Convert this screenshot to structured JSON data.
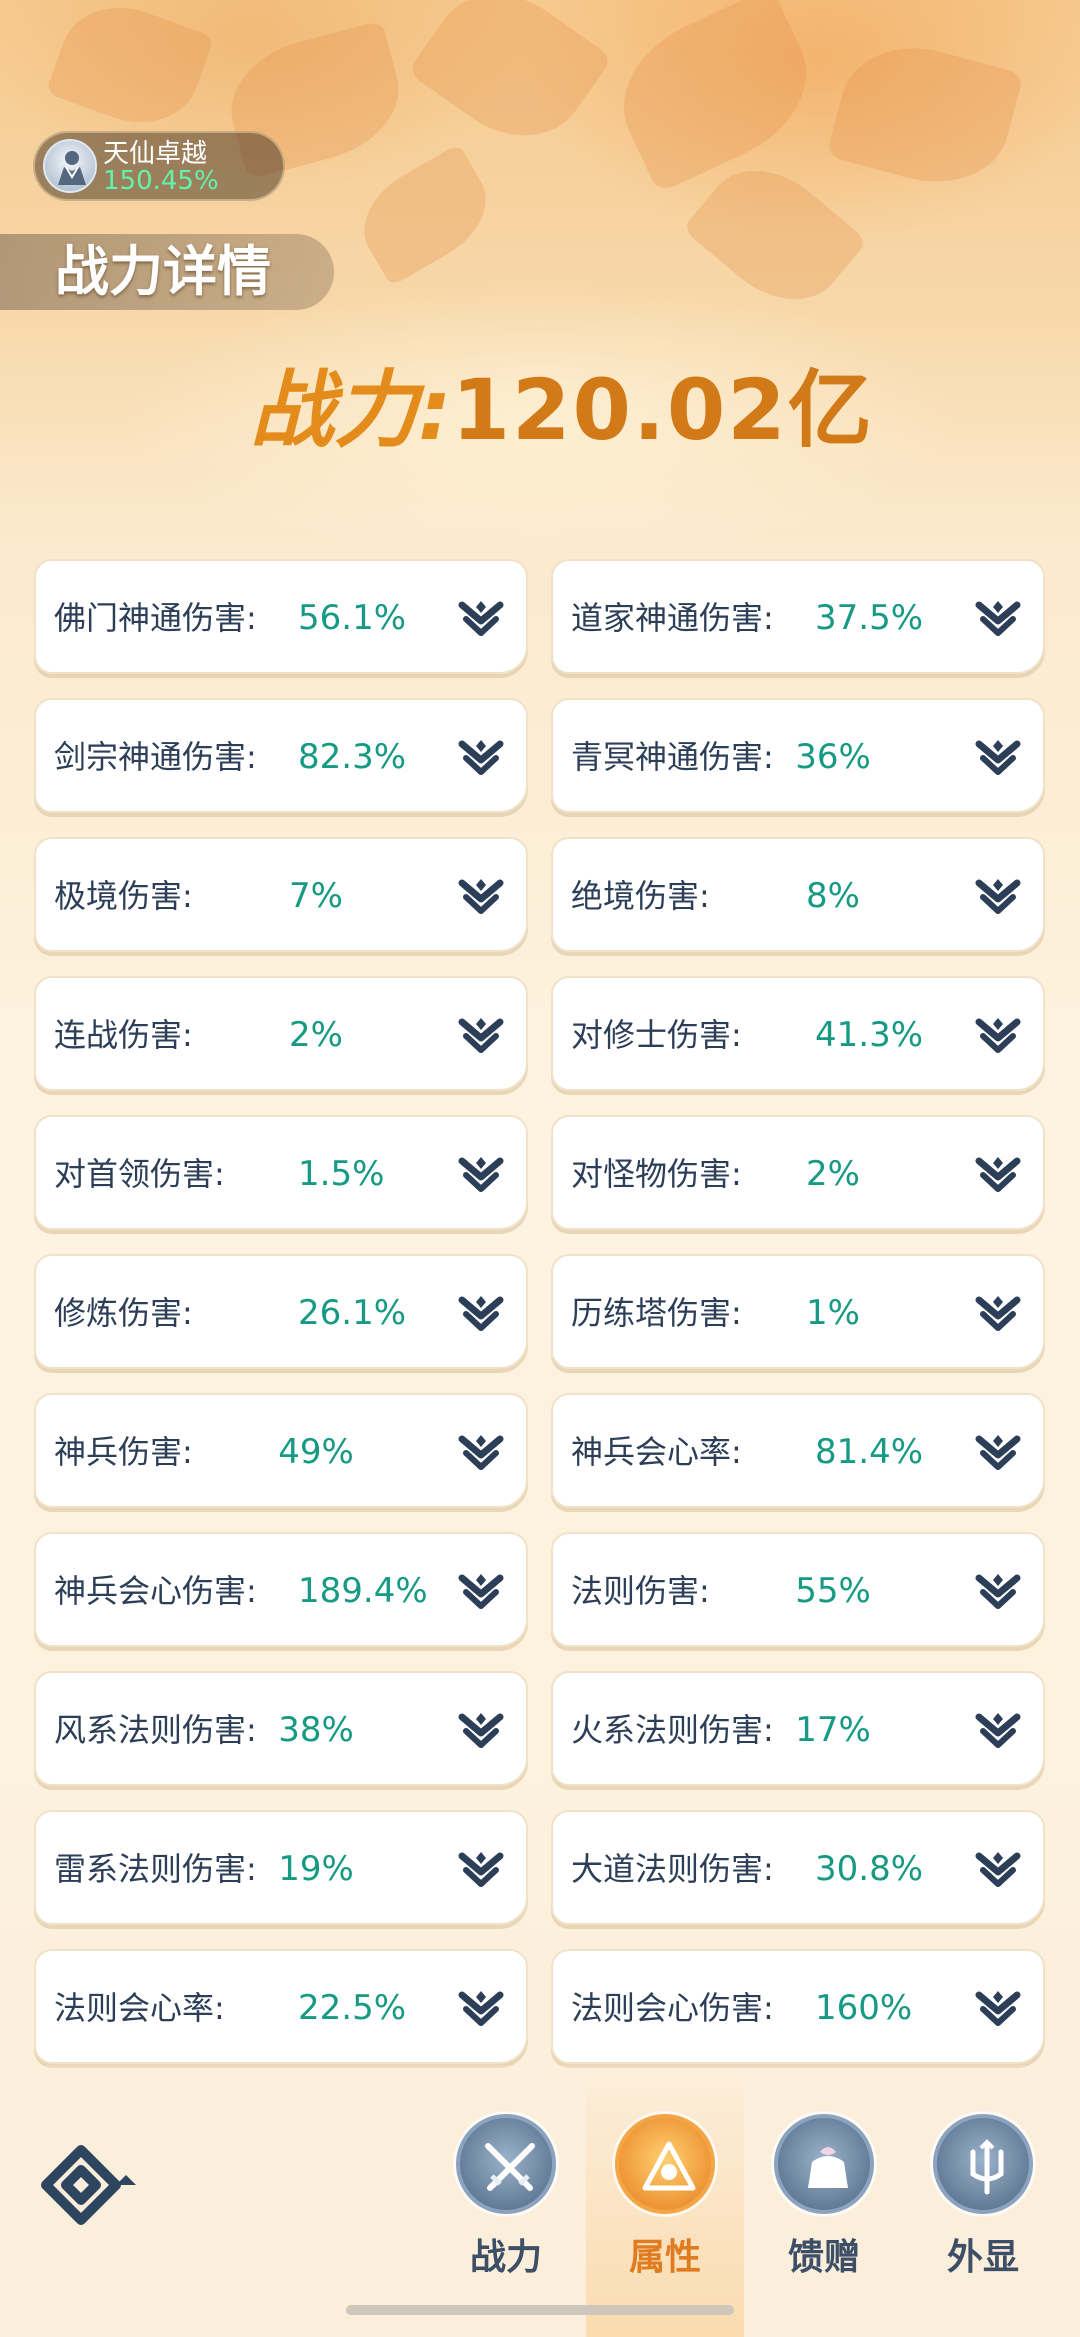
{
  "rank": {
    "icon": "immortal-avatar-icon",
    "name": "天仙卓越",
    "percent": "150.45%"
  },
  "page_title": "战力详情",
  "power": {
    "label": "战力",
    "colon": ":",
    "value": "120.02亿"
  },
  "stats": [
    {
      "label": "佛门神通伤害:",
      "value": "56.1%"
    },
    {
      "label": "道家神通伤害:",
      "value": "37.5%"
    },
    {
      "label": "剑宗神通伤害:",
      "value": "82.3%"
    },
    {
      "label": "青冥神通伤害:",
      "value": "36%"
    },
    {
      "label": "极境伤害:",
      "value": "7%"
    },
    {
      "label": "绝境伤害:",
      "value": "8%"
    },
    {
      "label": "连战伤害:",
      "value": "2%"
    },
    {
      "label": "对修士伤害:",
      "value": "41.3%"
    },
    {
      "label": "对首领伤害:",
      "value": "1.5%"
    },
    {
      "label": "对怪物伤害:",
      "value": "2%"
    },
    {
      "label": "修炼伤害:",
      "value": "26.1%"
    },
    {
      "label": "历练塔伤害:",
      "value": "1%"
    },
    {
      "label": "神兵伤害:",
      "value": "49%"
    },
    {
      "label": "神兵会心率:",
      "value": "81.4%"
    },
    {
      "label": "神兵会心伤害:",
      "value": "189.4%"
    },
    {
      "label": "法则伤害:",
      "value": "55%"
    },
    {
      "label": "风系法则伤害:",
      "value": "38%"
    },
    {
      "label": "火系法则伤害:",
      "value": "17%"
    },
    {
      "label": "雷系法则伤害:",
      "value": "19%"
    },
    {
      "label": "大道法则伤害:",
      "value": "30.8%"
    },
    {
      "label": "法则会心率:",
      "value": "22.5%"
    },
    {
      "label": "法则会心伤害:",
      "value": "160%"
    }
  ],
  "tabs": [
    {
      "label": "战力",
      "icon": "crossed-swords-icon",
      "active": false
    },
    {
      "label": "属性",
      "icon": "triangle-emblem-icon",
      "active": true
    },
    {
      "label": "馈赠",
      "icon": "gift-bag-icon",
      "active": false
    },
    {
      "label": "外显",
      "icon": "trident-crest-icon",
      "active": false
    }
  ],
  "colors": {
    "accent": "#e38b1b",
    "value_green": "#169a83",
    "label_navy": "#2d3f58"
  }
}
